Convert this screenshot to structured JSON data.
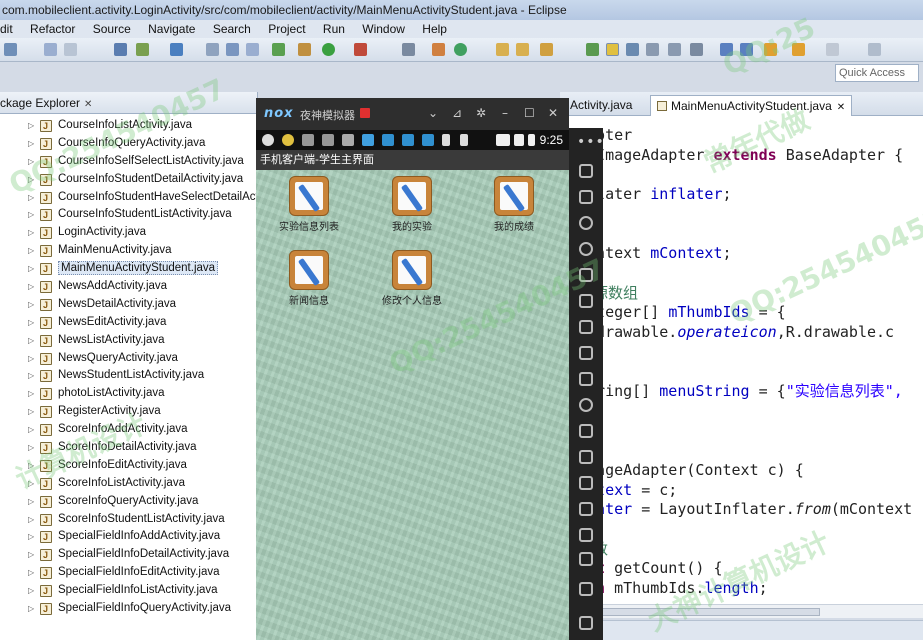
{
  "window": {
    "title": "com.mobileclient.activity.LoginActivity/src/com/mobileclient/activity/MainMenuActivityStudent.java - Eclipse"
  },
  "menu": [
    "dit",
    "Refactor",
    "Source",
    "Navigate",
    "Search",
    "Project",
    "Run",
    "Window",
    "Help"
  ],
  "quick_access": "Quick Access",
  "package_explorer": {
    "tab_label": "ckage Explorer",
    "items": [
      "CourseInfoListActivity.java",
      "CourseInfoQueryActivity.java",
      "CourseInfoSelfSelectListActivity.java",
      "CourseInfoStudentDetailActivity.java",
      "CourseInfoStudentHaveSelectDetailAct",
      "CourseInfoStudentListActivity.java",
      "LoginActivity.java",
      "MainMenuActivity.java",
      "MainMenuActivityStudent.java",
      "NewsAddActivity.java",
      "NewsDetailActivity.java",
      "NewsEditActivity.java",
      "NewsListActivity.java",
      "NewsQueryActivity.java",
      "NewsStudentListActivity.java",
      "photoListActivity.java",
      "RegisterActivity.java",
      "ScoreInfoAddActivity.java",
      "ScoreInfoDetailActivity.java",
      "ScoreInfoEditActivity.java",
      "ScoreInfoListActivity.java",
      "ScoreInfoQueryActivity.java",
      "ScoreInfoStudentListActivity.java",
      "SpecialFieldInfoAddActivity.java",
      "SpecialFieldInfoDetailActivity.java",
      "SpecialFieldInfoEditActivity.java",
      "SpecialFieldInfoListActivity.java",
      "SpecialFieldInfoQueryActivity.java"
    ],
    "selected_index": 8
  },
  "editor": {
    "tabs": [
      "Activity.java",
      "MainMenuActivityStudent.java"
    ],
    "code": {
      "l1": "dapter",
      "l2a": "s ImageAdapter ",
      "l2kw": "extends",
      "l2b": " BaseAdapter {",
      "l3a": "nflater ",
      "l3b": "inflater",
      "l3c": ";",
      "l4": "",
      "l5a": "Context ",
      "l5b": "mContext",
      "l5c": ";",
      "l6": "资源数组",
      "l7a": "Integer[] ",
      "l7b": "mThumbIds",
      "l7c": " = {",
      "l8a": "R.drawable.",
      "l8b": "operateicon",
      "l8c": ",R.drawable.c",
      "l9a": "String[] ",
      "l9b": "menuString",
      "l9c": " = {",
      "l9d": "\"实验信息列表\",",
      "l10": "",
      "l11": "ImageAdapter(Context c) {",
      "l12a": "ontext",
      "l12b": " = c;",
      "l13a": "flater",
      "l13b": " = LayoutInflater.",
      "l13c": "from",
      "l13d": "(mContext",
      "l14": "个数",
      "l15kw": "int",
      "l15b": " getCount() {",
      "l16kw": "urn",
      "l16b": " mThumbIds.",
      "l16c": "length",
      "l16d": ";"
    }
  },
  "emulator": {
    "brand": "nox",
    "title": "夜神模拟器",
    "clock": "9:25",
    "app_title": "手机客户端-学生主界面",
    "tiles": [
      "实验信息列表",
      "我的实验",
      "我的成绩",
      "新闻信息",
      "修改个人信息"
    ]
  },
  "watermarks": [
    "QQ:254540457",
    "常年代做",
    "QQ:254540457",
    "计算机设计",
    "QQ:254540457",
    "大神计算机设计",
    "QQ:25"
  ]
}
